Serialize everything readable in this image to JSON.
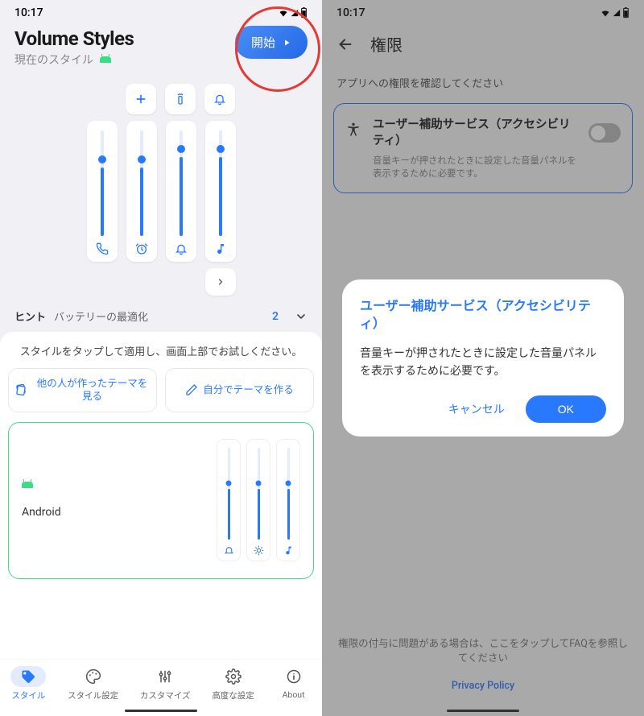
{
  "status": {
    "time": "10:17"
  },
  "left": {
    "title": "Volume Styles",
    "subtitle": "現在のスタイル",
    "start": "開始",
    "sliders": [
      {
        "level": 65,
        "icon": "phone"
      },
      {
        "level": 65,
        "icon": "alarm"
      },
      {
        "level": 75,
        "icon": "bell"
      },
      {
        "level": 75,
        "icon": "music"
      }
    ],
    "hint": {
      "label": "ヒント",
      "text": "バッテリーの最適化",
      "count": "2"
    },
    "panel": {
      "desc": "スタイルをタップして適用し、画面上部でお試しください。",
      "browse": "他の人が作ったテーマを見る",
      "create": "自分でテーマを作る"
    },
    "theme": {
      "name": "Android",
      "sliders": [
        {
          "level": 55,
          "icon": "bell"
        },
        {
          "level": 55,
          "icon": "brightness"
        },
        {
          "level": 55,
          "icon": "music"
        }
      ]
    },
    "nav": {
      "style": "スタイル",
      "style_settings": "スタイル設定",
      "customize": "カスタマイズ",
      "advanced": "高度な設定",
      "about": "About"
    }
  },
  "right": {
    "title": "権限",
    "desc": "アプリへの権限を確認してください",
    "perm": {
      "title": "ユーザー補助サービス（アクセシビリティ）",
      "sub": "音量キーが押されたときに設定した音量パネルを表示するために必要です。"
    },
    "faq": "権限の付与に問題がある場合は、ここをタップしてFAQを参照してください",
    "privacy": "Privacy Policy",
    "dialog": {
      "title": "ユーザー補助サービス（アクセシビリティ）",
      "body": "音量キーが押されたときに設定した音量パネルを表示するために必要です。",
      "cancel": "キャンセル",
      "ok": "OK"
    }
  }
}
